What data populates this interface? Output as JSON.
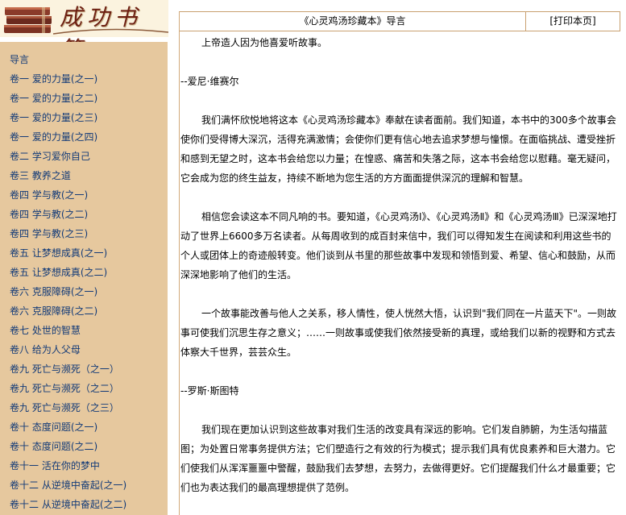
{
  "sidebar": {
    "logo_text": "成功书籍",
    "logo_icon": "books-icon",
    "items": [
      {
        "label": "导言"
      },
      {
        "label": "卷一  爱的力量(之一)"
      },
      {
        "label": "卷一  爱的力量(之二)"
      },
      {
        "label": "卷一  爱的力量(之三)"
      },
      {
        "label": "卷一  爱的力量(之四)"
      },
      {
        "label": "卷二   学习爱你自己"
      },
      {
        "label": "卷三  教养之道"
      },
      {
        "label": "卷四  学与教(之一)"
      },
      {
        "label": "卷四  学与教(之二)"
      },
      {
        "label": "卷四  学与教(之三)"
      },
      {
        "label": "卷五  让梦想成真(之一)"
      },
      {
        "label": "卷五  让梦想成真(之二)"
      },
      {
        "label": "卷六  克服障碍(之一)"
      },
      {
        "label": "卷六  克服障碍(之二)"
      },
      {
        "label": "卷七  处世的智慧"
      },
      {
        "label": "卷八  给为人父母"
      },
      {
        "label": "卷九  死亡与濒死（之一）"
      },
      {
        "label": "卷九  死亡与濒死（之二）"
      },
      {
        "label": "卷九  死亡与濒死（之三）"
      },
      {
        "label": "卷十  态度问题(之一)"
      },
      {
        "label": "卷十  态度问题(之二)"
      },
      {
        "label": "卷十一  活在你的梦中"
      },
      {
        "label": "卷十二  从逆境中奋起(之一)"
      },
      {
        "label": "卷十二  从逆境中奋起(之二)"
      }
    ]
  },
  "header": {
    "title": "《心灵鸡汤珍藏本》导言",
    "print_label": "[打印本页]"
  },
  "content": {
    "p1": "上帝造人因为他喜爱听故事。",
    "p2": "--爱尼·维赛尔",
    "p3": "我们满怀欣悦地将这本《心灵鸡汤珍藏本》奉献在读者面前。我们知道，本书中的300多个故事会使你们受得博大深沉，活得充满激情；会使你们更有信心地去追求梦想与憧憬。在面临挑战、遭受挫折和感到无望之时，这本书会给您以力量；在惶惑、痛苦和失落之际，这本书会给您以慰藉。毫无疑问，它会成为您的终生益友，持续不断地为您生活的方方面面提供深沉的理解和智慧。",
    "p4": "相信您会读这本不同凡响的书。要知道，《心灵鸡汤Ⅰ》、《心灵鸡汤Ⅱ》和《心灵鸡汤Ⅲ》已深深地打动了世界上6600多万名读者。从每周收到的成百封来信中，我们可以得知发生在阅读和利用这些书的个人或团体上的奇迹般转变。他们谈到从书里的那些故事中发现和领悟到爱、希望、信心和鼓励，从而深深地影响了他们的生活。",
    "p5": "一个故事能改善与他人之关系，移人情性，使人恍然大悟，认识到\"我们同在一片蓝天下\"。一则故事可使我们沉思生存之意义；……一则故事或使我们依然接受新的真理，或给我们以新的视野和方式去体察大千世界，芸芸众生。",
    "p6": "--罗斯·斯图特",
    "p7": "我们现在更加认识到这些故事对我们生活的改变具有深远的影响。它们发自肺腑，为生活勾描蓝图；为处置日常事务提供方法；它们塑造行之有效的行为模式；提示我们具有优良素养和巨大潜力。它们使我们从浑浑噩噩中警醒，鼓励我们去梦想，去努力，去做得更好。它们提醒我们什么才最重要；它们也为表达我们的最高理想提供了范例。"
  },
  "colors": {
    "sidebar_bg": "#e6c89e",
    "link": "#123a78",
    "border": "#c9a070",
    "logo_text": "#6d1f12"
  }
}
